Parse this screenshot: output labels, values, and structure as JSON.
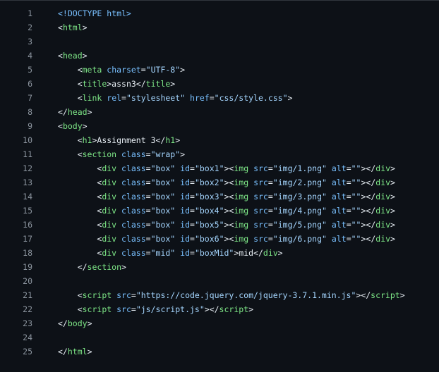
{
  "theme": {
    "background": "#0d1117",
    "text": "#e6edf3",
    "line_number": "#8b949e",
    "tag": "#7ee787",
    "attribute": "#79c0ff",
    "string": "#a5d6ff"
  },
  "lines": [
    {
      "n": "1",
      "tokens": [
        [
          "doctype",
          "<!DOCTYPE html>"
        ]
      ]
    },
    {
      "n": "2",
      "tokens": [
        [
          "default",
          "<"
        ],
        [
          "tag",
          "html"
        ],
        [
          "default",
          ">"
        ]
      ]
    },
    {
      "n": "3",
      "tokens": []
    },
    {
      "n": "4",
      "tokens": [
        [
          "default",
          "<"
        ],
        [
          "tag",
          "head"
        ],
        [
          "default",
          ">"
        ]
      ]
    },
    {
      "n": "5",
      "tokens": [
        [
          "default",
          "    <"
        ],
        [
          "tag",
          "meta"
        ],
        [
          "default",
          " "
        ],
        [
          "attr",
          "charset"
        ],
        [
          "default",
          "="
        ],
        [
          "str",
          "\"UTF-8\""
        ],
        [
          "default",
          ">"
        ]
      ]
    },
    {
      "n": "6",
      "tokens": [
        [
          "default",
          "    <"
        ],
        [
          "tag",
          "title"
        ],
        [
          "default",
          ">assn3</"
        ],
        [
          "tag",
          "title"
        ],
        [
          "default",
          ">"
        ]
      ]
    },
    {
      "n": "7",
      "tokens": [
        [
          "default",
          "    <"
        ],
        [
          "tag",
          "link"
        ],
        [
          "default",
          " "
        ],
        [
          "attr",
          "rel"
        ],
        [
          "default",
          "="
        ],
        [
          "str",
          "\"stylesheet\""
        ],
        [
          "default",
          " "
        ],
        [
          "attr",
          "href"
        ],
        [
          "default",
          "="
        ],
        [
          "str",
          "\"css/style.css\""
        ],
        [
          "default",
          ">"
        ]
      ]
    },
    {
      "n": "8",
      "tokens": [
        [
          "default",
          "</"
        ],
        [
          "tag",
          "head"
        ],
        [
          "default",
          ">"
        ]
      ]
    },
    {
      "n": "9",
      "tokens": [
        [
          "default",
          "<"
        ],
        [
          "tag",
          "body"
        ],
        [
          "default",
          ">"
        ]
      ]
    },
    {
      "n": "10",
      "tokens": [
        [
          "default",
          "    <"
        ],
        [
          "tag",
          "h1"
        ],
        [
          "default",
          ">Assignment 3</"
        ],
        [
          "tag",
          "h1"
        ],
        [
          "default",
          ">"
        ]
      ]
    },
    {
      "n": "11",
      "tokens": [
        [
          "default",
          "    <"
        ],
        [
          "tag",
          "section"
        ],
        [
          "default",
          " "
        ],
        [
          "attr",
          "class"
        ],
        [
          "default",
          "="
        ],
        [
          "str",
          "\"wrap\""
        ],
        [
          "default",
          ">"
        ]
      ]
    },
    {
      "n": "12",
      "tokens": [
        [
          "default",
          "        <"
        ],
        [
          "tag",
          "div"
        ],
        [
          "default",
          " "
        ],
        [
          "attr",
          "class"
        ],
        [
          "default",
          "="
        ],
        [
          "str",
          "\"box\""
        ],
        [
          "default",
          " "
        ],
        [
          "attr",
          "id"
        ],
        [
          "default",
          "="
        ],
        [
          "str",
          "\"box1\""
        ],
        [
          "default",
          "><"
        ],
        [
          "tag",
          "img"
        ],
        [
          "default",
          " "
        ],
        [
          "attr",
          "src"
        ],
        [
          "default",
          "="
        ],
        [
          "str",
          "\"img/1.png\""
        ],
        [
          "default",
          " "
        ],
        [
          "attr",
          "alt"
        ],
        [
          "default",
          "="
        ],
        [
          "str",
          "\"\""
        ],
        [
          "default",
          "></"
        ],
        [
          "tag",
          "div"
        ],
        [
          "default",
          ">"
        ]
      ]
    },
    {
      "n": "13",
      "tokens": [
        [
          "default",
          "        <"
        ],
        [
          "tag",
          "div"
        ],
        [
          "default",
          " "
        ],
        [
          "attr",
          "class"
        ],
        [
          "default",
          "="
        ],
        [
          "str",
          "\"box\""
        ],
        [
          "default",
          " "
        ],
        [
          "attr",
          "id"
        ],
        [
          "default",
          "="
        ],
        [
          "str",
          "\"box2\""
        ],
        [
          "default",
          "><"
        ],
        [
          "tag",
          "img"
        ],
        [
          "default",
          " "
        ],
        [
          "attr",
          "src"
        ],
        [
          "default",
          "="
        ],
        [
          "str",
          "\"img/2.png\""
        ],
        [
          "default",
          " "
        ],
        [
          "attr",
          "alt"
        ],
        [
          "default",
          "="
        ],
        [
          "str",
          "\"\""
        ],
        [
          "default",
          "></"
        ],
        [
          "tag",
          "div"
        ],
        [
          "default",
          ">"
        ]
      ]
    },
    {
      "n": "14",
      "tokens": [
        [
          "default",
          "        <"
        ],
        [
          "tag",
          "div"
        ],
        [
          "default",
          " "
        ],
        [
          "attr",
          "class"
        ],
        [
          "default",
          "="
        ],
        [
          "str",
          "\"box\""
        ],
        [
          "default",
          " "
        ],
        [
          "attr",
          "id"
        ],
        [
          "default",
          "="
        ],
        [
          "str",
          "\"box3\""
        ],
        [
          "default",
          "><"
        ],
        [
          "tag",
          "img"
        ],
        [
          "default",
          " "
        ],
        [
          "attr",
          "src"
        ],
        [
          "default",
          "="
        ],
        [
          "str",
          "\"img/3.png\""
        ],
        [
          "default",
          " "
        ],
        [
          "attr",
          "alt"
        ],
        [
          "default",
          "="
        ],
        [
          "str",
          "\"\""
        ],
        [
          "default",
          "></"
        ],
        [
          "tag",
          "div"
        ],
        [
          "default",
          ">"
        ]
      ]
    },
    {
      "n": "15",
      "tokens": [
        [
          "default",
          "        <"
        ],
        [
          "tag",
          "div"
        ],
        [
          "default",
          " "
        ],
        [
          "attr",
          "class"
        ],
        [
          "default",
          "="
        ],
        [
          "str",
          "\"box\""
        ],
        [
          "default",
          " "
        ],
        [
          "attr",
          "id"
        ],
        [
          "default",
          "="
        ],
        [
          "str",
          "\"box4\""
        ],
        [
          "default",
          "><"
        ],
        [
          "tag",
          "img"
        ],
        [
          "default",
          " "
        ],
        [
          "attr",
          "src"
        ],
        [
          "default",
          "="
        ],
        [
          "str",
          "\"img/4.png\""
        ],
        [
          "default",
          " "
        ],
        [
          "attr",
          "alt"
        ],
        [
          "default",
          "="
        ],
        [
          "str",
          "\"\""
        ],
        [
          "default",
          "></"
        ],
        [
          "tag",
          "div"
        ],
        [
          "default",
          ">"
        ]
      ]
    },
    {
      "n": "16",
      "tokens": [
        [
          "default",
          "        <"
        ],
        [
          "tag",
          "div"
        ],
        [
          "default",
          " "
        ],
        [
          "attr",
          "class"
        ],
        [
          "default",
          "="
        ],
        [
          "str",
          "\"box\""
        ],
        [
          "default",
          " "
        ],
        [
          "attr",
          "id"
        ],
        [
          "default",
          "="
        ],
        [
          "str",
          "\"box5\""
        ],
        [
          "default",
          "><"
        ],
        [
          "tag",
          "img"
        ],
        [
          "default",
          " "
        ],
        [
          "attr",
          "src"
        ],
        [
          "default",
          "="
        ],
        [
          "str",
          "\"img/5.png\""
        ],
        [
          "default",
          " "
        ],
        [
          "attr",
          "alt"
        ],
        [
          "default",
          "="
        ],
        [
          "str",
          "\"\""
        ],
        [
          "default",
          "></"
        ],
        [
          "tag",
          "div"
        ],
        [
          "default",
          ">"
        ]
      ]
    },
    {
      "n": "17",
      "tokens": [
        [
          "default",
          "        <"
        ],
        [
          "tag",
          "div"
        ],
        [
          "default",
          " "
        ],
        [
          "attr",
          "class"
        ],
        [
          "default",
          "="
        ],
        [
          "str",
          "\"box\""
        ],
        [
          "default",
          " "
        ],
        [
          "attr",
          "id"
        ],
        [
          "default",
          "="
        ],
        [
          "str",
          "\"box6\""
        ],
        [
          "default",
          "><"
        ],
        [
          "tag",
          "img"
        ],
        [
          "default",
          " "
        ],
        [
          "attr",
          "src"
        ],
        [
          "default",
          "="
        ],
        [
          "str",
          "\"img/6.png\""
        ],
        [
          "default",
          " "
        ],
        [
          "attr",
          "alt"
        ],
        [
          "default",
          "="
        ],
        [
          "str",
          "\"\""
        ],
        [
          "default",
          "></"
        ],
        [
          "tag",
          "div"
        ],
        [
          "default",
          ">"
        ]
      ]
    },
    {
      "n": "18",
      "tokens": [
        [
          "default",
          "        <"
        ],
        [
          "tag",
          "div"
        ],
        [
          "default",
          " "
        ],
        [
          "attr",
          "class"
        ],
        [
          "default",
          "="
        ],
        [
          "str",
          "\"mid\""
        ],
        [
          "default",
          " "
        ],
        [
          "attr",
          "id"
        ],
        [
          "default",
          "="
        ],
        [
          "str",
          "\"boxMid\""
        ],
        [
          "default",
          ">mid</"
        ],
        [
          "tag",
          "div"
        ],
        [
          "default",
          ">"
        ]
      ]
    },
    {
      "n": "19",
      "tokens": [
        [
          "default",
          "    </"
        ],
        [
          "tag",
          "section"
        ],
        [
          "default",
          ">"
        ]
      ]
    },
    {
      "n": "20",
      "tokens": []
    },
    {
      "n": "21",
      "tokens": [
        [
          "default",
          "    <"
        ],
        [
          "tag",
          "script"
        ],
        [
          "default",
          " "
        ],
        [
          "attr",
          "src"
        ],
        [
          "default",
          "="
        ],
        [
          "str",
          "\"https://code.jquery.com/jquery-3.7.1.min.js\""
        ],
        [
          "default",
          "></"
        ],
        [
          "tag",
          "script"
        ],
        [
          "default",
          ">"
        ]
      ]
    },
    {
      "n": "22",
      "tokens": [
        [
          "default",
          "    <"
        ],
        [
          "tag",
          "script"
        ],
        [
          "default",
          " "
        ],
        [
          "attr",
          "src"
        ],
        [
          "default",
          "="
        ],
        [
          "str",
          "\"js/script.js\""
        ],
        [
          "default",
          "></"
        ],
        [
          "tag",
          "script"
        ],
        [
          "default",
          ">"
        ]
      ]
    },
    {
      "n": "23",
      "tokens": [
        [
          "default",
          "</"
        ],
        [
          "tag",
          "body"
        ],
        [
          "default",
          ">"
        ]
      ]
    },
    {
      "n": "24",
      "tokens": []
    },
    {
      "n": "25",
      "tokens": [
        [
          "default",
          "</"
        ],
        [
          "tag",
          "html"
        ],
        [
          "default",
          ">"
        ]
      ]
    }
  ]
}
